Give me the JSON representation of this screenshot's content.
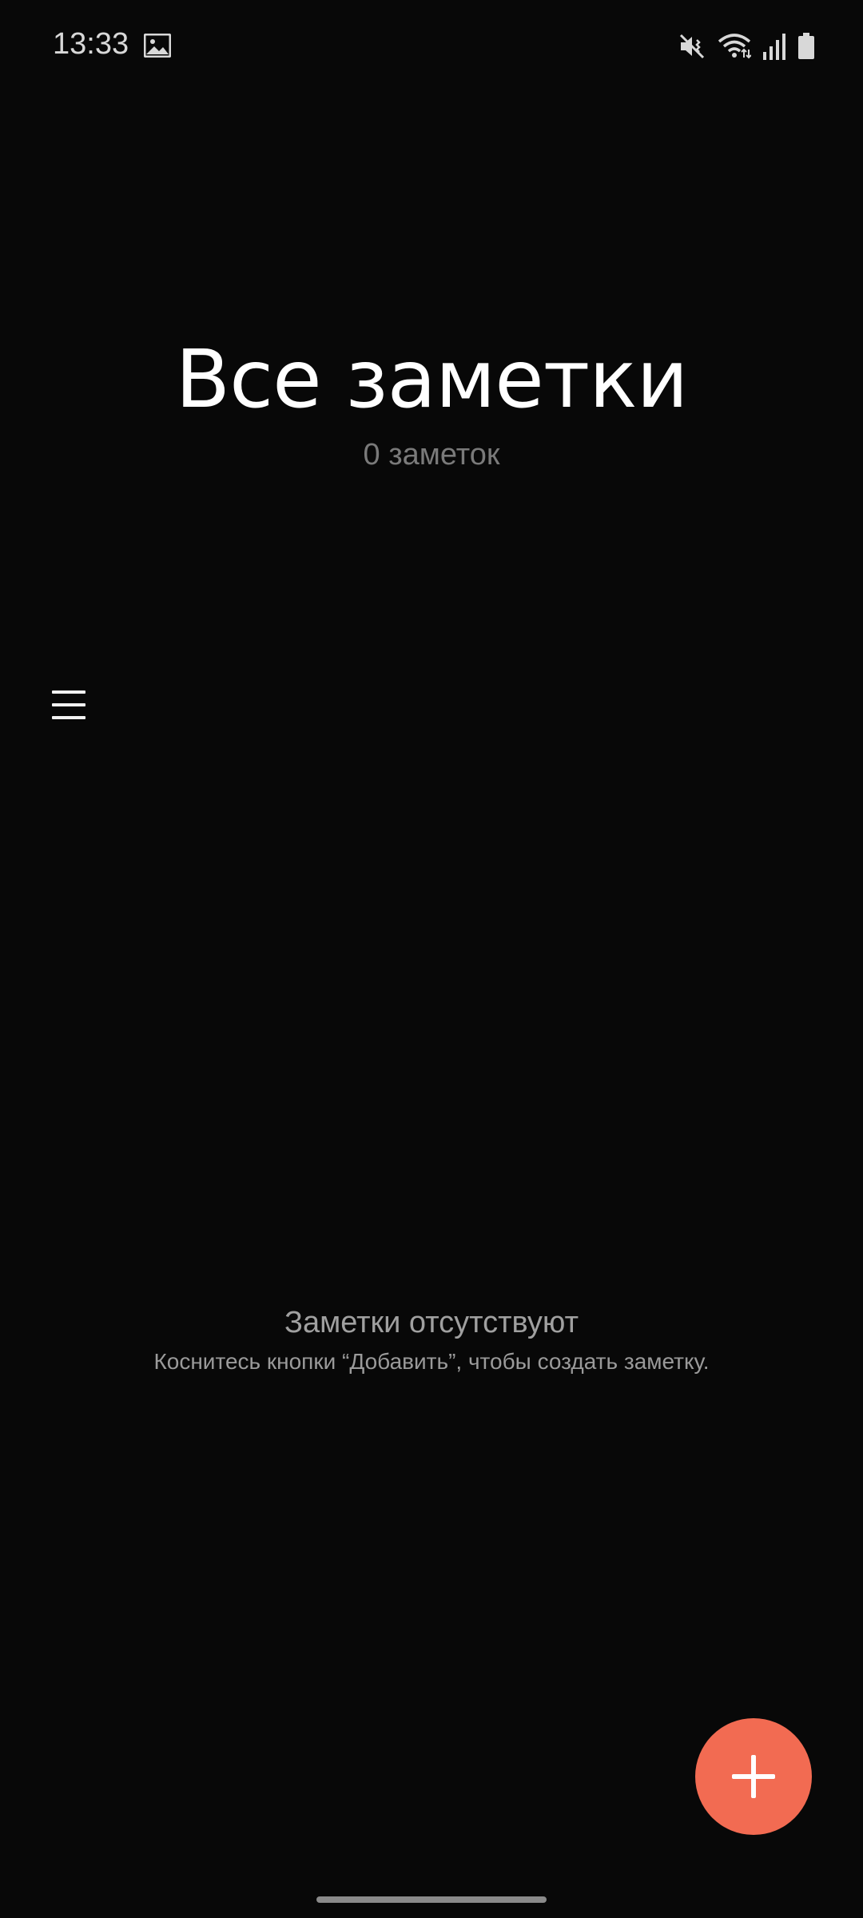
{
  "status_bar": {
    "time": "13:33",
    "icons": [
      "gallery-icon",
      "mute-vibrate-icon",
      "wifi-icon",
      "signal-icon",
      "battery-icon"
    ]
  },
  "header": {
    "title": "Все заметки",
    "subtitle": "0 заметок"
  },
  "menu": {
    "icon": "hamburger-menu-icon"
  },
  "empty_state": {
    "title": "Заметки отсутствуют",
    "hint": "Коснитесь кнопки “Добавить”, чтобы создать заметку."
  },
  "fab": {
    "icon": "plus-icon",
    "color": "#f26b52"
  },
  "colors": {
    "background": "#080808",
    "accent": "#f26b52"
  }
}
